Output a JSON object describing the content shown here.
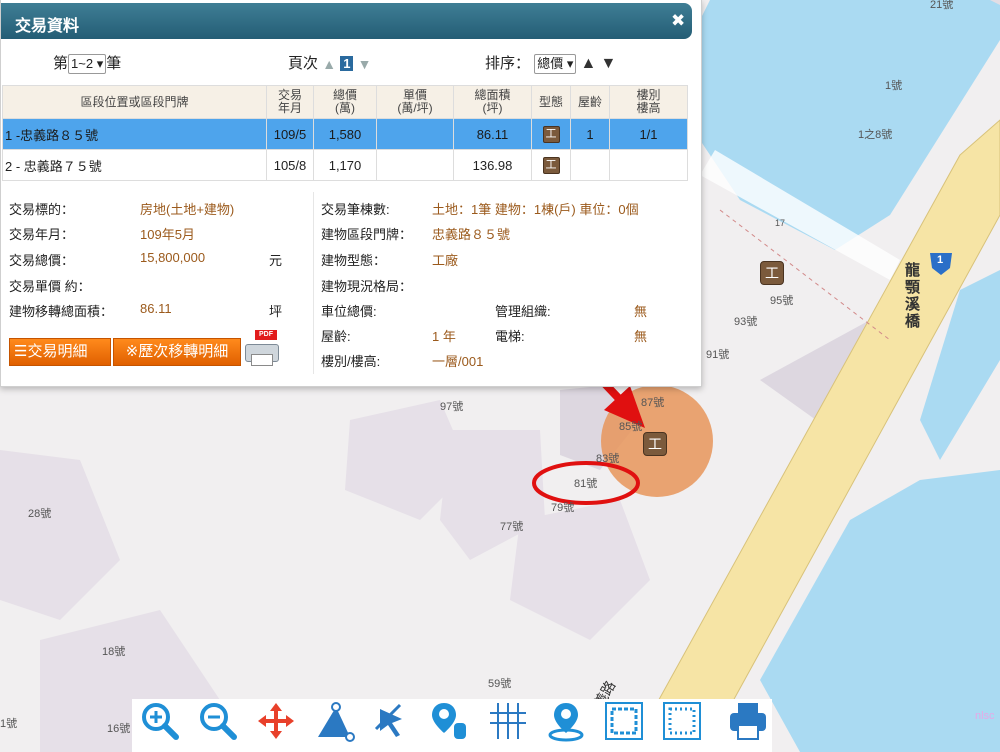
{
  "panel": {
    "title": "交易資料",
    "close": "✖",
    "pager": {
      "prefix": "第",
      "range": "1~2",
      "suffix": "筆",
      "page_label": "頁次",
      "page_num": "1",
      "sort_label": "排序：",
      "sort_value": "總價"
    },
    "columns": [
      "區段位置或區段門牌",
      "交易\n年月",
      "總價\n(萬)",
      "單價\n(萬/坪)",
      "總面積\n(坪)",
      "型態",
      "屋齡",
      "樓別\n樓高"
    ],
    "rows": [
      {
        "addr": "1 -忠義路８５號",
        "date": "109/5",
        "price": "1,580",
        "unit": "",
        "area": "86.11",
        "type": "工",
        "age": "1",
        "floor": "1/1"
      },
      {
        "addr": "2 - 忠義路７５號",
        "date": "105/8",
        "price": "1,170",
        "unit": "",
        "area": "136.98",
        "type": "工",
        "age": "",
        "floor": ""
      }
    ],
    "details_left": [
      {
        "label": "交易標的：",
        "value": "房地(土地+建物)",
        "unit": ""
      },
      {
        "label": "交易年月：",
        "value": "109年5月",
        "unit": ""
      },
      {
        "label": "交易總價：",
        "value": "15,800,000",
        "unit": "元"
      },
      {
        "label": "交易單價 約：",
        "value": "",
        "unit": ""
      },
      {
        "label": "建物移轉總面積：",
        "value": "86.11",
        "unit": "坪"
      }
    ],
    "details_right": [
      {
        "label": "交易筆棟數:",
        "value": "土地：1筆 建物：1棟(戶) 車位：0個"
      },
      {
        "label": "建物區段門牌：",
        "value": "忠義路８５號"
      },
      {
        "label": "建物型態：",
        "value": "工廠"
      },
      {
        "label": "建物現況格局：",
        "value": ""
      },
      {
        "label": "車位總價:",
        "value": ""
      },
      {
        "label": "屋齡:",
        "value": "1 年"
      },
      {
        "label": "樓別/樓高:",
        "value": "一層/001"
      }
    ],
    "details_extra": [
      {
        "label": "管理組織:",
        "value": "無"
      },
      {
        "label": "電梯:",
        "value": "無"
      }
    ],
    "buttons": {
      "detail": "交易明細",
      "history": "※歷次移轉明細",
      "pdf_tag": "PDF"
    }
  },
  "map": {
    "labels": [
      {
        "text": "21號"
      },
      {
        "text": "1號"
      },
      {
        "text": "1之8號"
      },
      {
        "text": "17"
      },
      {
        "text": "95號"
      },
      {
        "text": "93號"
      },
      {
        "text": "91號"
      },
      {
        "text": "97號"
      },
      {
        "text": "87號"
      },
      {
        "text": "85號"
      },
      {
        "text": "83號"
      },
      {
        "text": "81號"
      },
      {
        "text": "79號"
      },
      {
        "text": "77號"
      },
      {
        "text": "28號"
      },
      {
        "text": "18號"
      },
      {
        "text": "59號"
      },
      {
        "text": "16號"
      },
      {
        "text": "1號"
      },
      {
        "text": "nlsc"
      }
    ],
    "bridge_label": "龍顎溪橋",
    "road_label": "忠義路",
    "route_shield": "1",
    "marker_label": "工",
    "colors": {
      "water": "#aadaf2",
      "road": "#f6e4a5",
      "highlight": "#e8955a",
      "annotation": "#e01010"
    }
  },
  "toolbar": {
    "tools": [
      {
        "name": "zoom-in-icon"
      },
      {
        "name": "zoom-out-icon"
      },
      {
        "name": "pan-icon"
      },
      {
        "name": "measure-area-icon"
      },
      {
        "name": "select-arrow-icon"
      },
      {
        "name": "point-query-icon"
      },
      {
        "name": "grid-icon"
      },
      {
        "name": "locate-pin-icon"
      },
      {
        "name": "frame-select-icon"
      },
      {
        "name": "frame-select-2-icon"
      },
      {
        "name": "print-icon"
      }
    ]
  }
}
